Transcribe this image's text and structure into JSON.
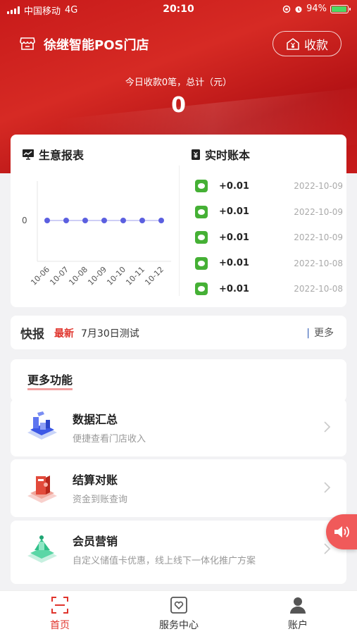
{
  "status_bar": {
    "carrier": "中国移动",
    "network": "4G",
    "time": "20:10",
    "battery": "94%",
    "battery_level": 0.94
  },
  "header": {
    "store_name": "徐继智能POS门店",
    "collect_label": "收款",
    "today_summary": "今日收款0笔，总计（元）",
    "total_amount": "0"
  },
  "report": {
    "title": "生意报表",
    "chart_data": {
      "type": "line",
      "categories": [
        "10-06",
        "10-07",
        "10-08",
        "10-09",
        "10-10",
        "10-11",
        "10-12"
      ],
      "values": [
        0,
        0,
        0,
        0,
        0,
        0,
        0
      ],
      "y_tick": "0",
      "color": "#5b5fe0"
    }
  },
  "ledger": {
    "title": "实时账本",
    "rows": [
      {
        "amount": "+0.01",
        "date": "2022-10-09"
      },
      {
        "amount": "+0.01",
        "date": "2022-10-09"
      },
      {
        "amount": "+0.01",
        "date": "2022-10-09"
      },
      {
        "amount": "+0.01",
        "date": "2022-10-08"
      },
      {
        "amount": "+0.01",
        "date": "2022-10-08"
      }
    ]
  },
  "news": {
    "label": "快报",
    "badge": "最新",
    "text": "7月30日测试",
    "more": "更多"
  },
  "features": {
    "title": "更多功能",
    "items": [
      {
        "title": "数据汇总",
        "subtitle": "便捷查看门店收入"
      },
      {
        "title": "结算对账",
        "subtitle": "资金到账查询"
      },
      {
        "title": "会员营销",
        "subtitle": "自定义储值卡优惠，线上线下一体化推广方案"
      }
    ]
  },
  "tabs": [
    {
      "label": "首页",
      "active": true
    },
    {
      "label": "服务中心",
      "active": false
    },
    {
      "label": "账户",
      "active": false
    }
  ],
  "colors": {
    "brand_red": "#c81a1a",
    "active_tab": "#e0342c",
    "wechat_green": "#45b035"
  }
}
